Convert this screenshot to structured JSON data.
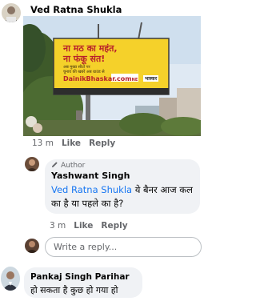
{
  "comment": {
    "author": "Ved Ratna Shukla",
    "image": {
      "billboard_line1": "ना मठ का महंत,",
      "billboard_line2": "ना फंकू संत!",
      "billboard_small1": "अब मुख्य सीटों पर",
      "billboard_small2": "चुनाव की खबरें अब ग्राउंड से",
      "billboard_url": "DainikBhaskar.com",
      "billboard_url_suffix": "NE",
      "billboard_logo": "भास्कर"
    },
    "time": "13 m",
    "like_label": "Like",
    "reply_label": "Reply"
  },
  "reply": {
    "badge": "Author",
    "author": "Yashwant Singh",
    "mention": "Ved Ratna Shukla",
    "text": " ये बैनर आज कल का है या पहले का है?",
    "time": "3 m",
    "like_label": "Like",
    "reply_label": "Reply"
  },
  "write_reply": {
    "placeholder": "Write a reply..."
  },
  "comment2": {
    "author": "Pankaj Singh Parihar",
    "text": "हो सकता है कुछ हो गया हो"
  },
  "colors": {
    "link": "#1877f2",
    "bubble": "#f0f2f5",
    "meta_gray": "#65676b",
    "billboard_yellow": "#f5d12a",
    "billboard_red": "#b8202b"
  }
}
